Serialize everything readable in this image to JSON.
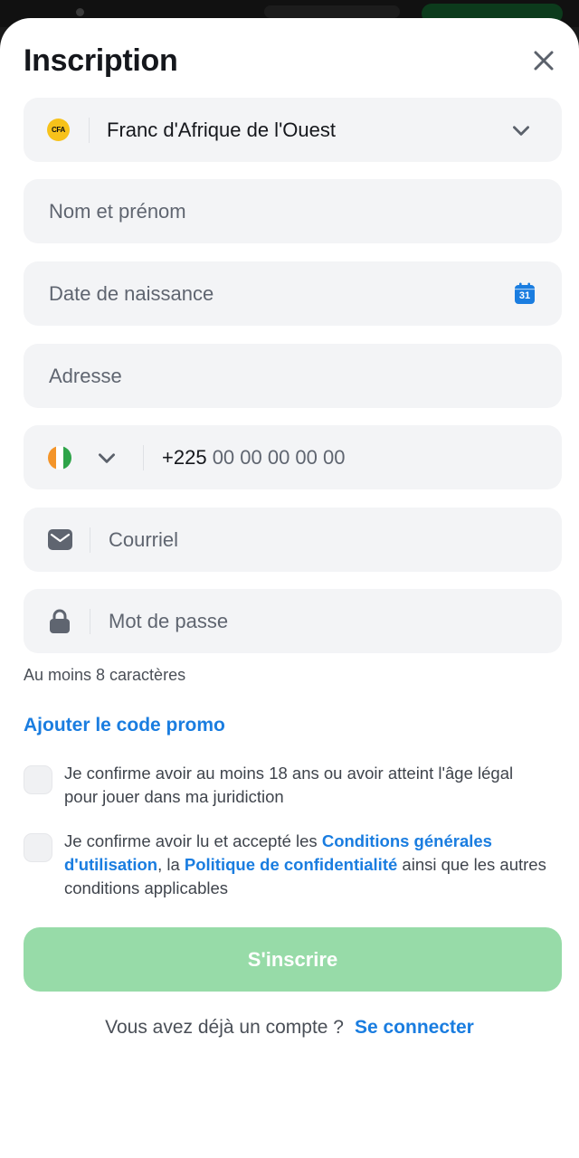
{
  "header": {
    "title": "Inscription",
    "close_icon": "close-icon"
  },
  "form": {
    "currency": {
      "badge": "CFA",
      "value": "Franc d'Afrique de l'Ouest",
      "icon": "chevron-down-icon"
    },
    "full_name": {
      "placeholder": "Nom et prénom"
    },
    "birth_date": {
      "placeholder": "Date de naissance",
      "icon": "calendar-icon",
      "icon_text": "31"
    },
    "address": {
      "placeholder": "Adresse"
    },
    "phone": {
      "country_flag": "cote-divoire-flag-icon",
      "prefix": "+225",
      "placeholder": "00 00 00 00 00"
    },
    "email": {
      "placeholder": "Courriel",
      "icon": "mail-icon"
    },
    "password": {
      "placeholder": "Mot de passe",
      "icon": "lock-icon",
      "hint": "Au moins 8 caractères"
    },
    "promo_link": "Ajouter le code promo",
    "consent_age": {
      "text": "Je confirme avoir au moins 18 ans ou avoir atteint l'âge légal pour jouer dans ma juridiction"
    },
    "consent_terms": {
      "text_1": "Je confirme avoir lu et accepté les ",
      "link_terms": "Conditions générales d'utilisation",
      "text_2": ", la ",
      "link_privacy": "Politique de confidentialité",
      "text_3": " ainsi que les autres conditions applicables"
    },
    "submit_label": "S'inscrire"
  },
  "footer": {
    "question": "Vous avez déjà un compte ?",
    "login_link": "Se connecter"
  },
  "colors": {
    "accent_link": "#1a7de0",
    "submit_disabled": "#97dba8",
    "field_bg": "#f3f4f6",
    "currency_badge": "#f7c21a",
    "calendar_icon": "#1a7de0"
  }
}
